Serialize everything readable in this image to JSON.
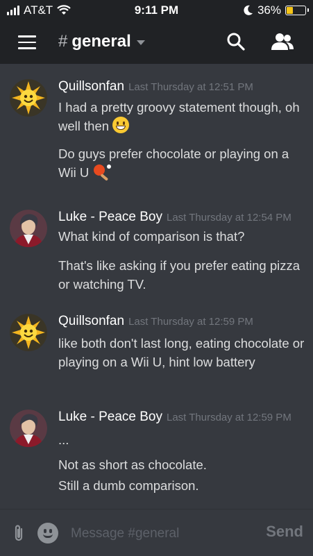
{
  "status_bar": {
    "carrier": "AT&T",
    "time": "9:11 PM",
    "battery_percent": "36%",
    "battery_level": 0.36,
    "icons": [
      "signal-icon",
      "wifi-icon",
      "moon-icon",
      "battery-icon"
    ]
  },
  "header": {
    "hash": "#",
    "channel": "general",
    "icons": [
      "menu-icon",
      "search-icon",
      "members-icon",
      "chevron-down-icon"
    ]
  },
  "messages": [
    {
      "author": "Quillsonfan",
      "timestamp": "Last Thursday at 12:51 PM",
      "lines": [
        "I had a pretty groovy statement though, oh well then",
        "Do guys prefer chocolate or playing on a Wii U"
      ],
      "emojis": [
        "grinning-emoji",
        "ping-pong-emoji"
      ]
    },
    {
      "author": "Luke - Peace Boy",
      "timestamp": "Last Thursday at 12:54 PM",
      "lines": [
        "What kind of comparison is that?",
        "That's like asking if you prefer eating pizza or watching TV."
      ]
    },
    {
      "author": "Quillsonfan",
      "timestamp": "Last Thursday at 12:59 PM",
      "lines": [
        "like both don't last long, eating chocolate or playing on a Wii U, hint low battery"
      ]
    },
    {
      "author": "Luke - Peace Boy",
      "timestamp": "Last Thursday at 12:59 PM",
      "lines": [
        "...",
        "Not as short as chocolate.",
        "Still a dumb comparison."
      ]
    }
  ],
  "composer": {
    "placeholder": "Message #general",
    "send_label": "Send",
    "icons": [
      "paperclip-icon",
      "emoji-icon"
    ]
  },
  "colors": {
    "background": "#36393f",
    "header_bg": "#202225",
    "text": "#dcddde",
    "timestamp": "#72767d",
    "battery": "#f5c518"
  }
}
